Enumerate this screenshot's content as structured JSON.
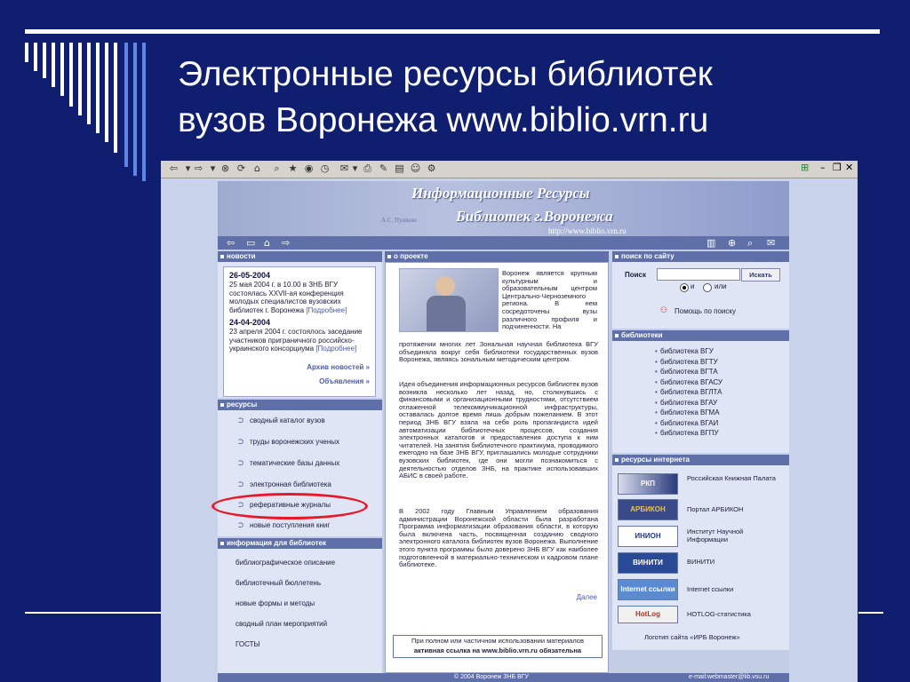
{
  "slide": {
    "title_line1": "Электронные ресурсы библиотек",
    "title_line2": "вузов Воронежа www.biblio.vrn.ru"
  },
  "banner": {
    "title_line1": "Информационные Ресурсы",
    "title_line2": "Библиотек г.Воронежа",
    "url": "http://www.biblio.vrn.ru",
    "signature": "А.С. Пушкин"
  },
  "news": {
    "header": "новости",
    "items": [
      {
        "date": "26-05-2004",
        "text": "25 мая 2004 г. в 10.00 в ЗНБ ВГУ состоялась XXVII-ая конференция молодых специалистов вузовских библиотек г. Воронежа",
        "more": "[Подробнее]"
      },
      {
        "date": "24-04-2004",
        "text": "23 апреля 2004 г. состоялось заседание участников приграничного российско-украинского консорциума",
        "more": "[Подробнее]"
      }
    ],
    "archive_link": "Архив новостей »",
    "ads_link": "Объявления »"
  },
  "resources": {
    "header": "ресурсы",
    "items": [
      "сводный каталог вузов",
      "труды воронежских ученых",
      "тематические базы данных",
      "электронная библиотека",
      "реферативные журналы",
      "новые поступления книг"
    ]
  },
  "info": {
    "header": "информация для библиотек",
    "items": [
      "библиографическое описание",
      "библиотечный бюллетень",
      "новые формы и методы",
      "сводный план мероприятий",
      "ГОСТЫ"
    ]
  },
  "about": {
    "header": "о проекте",
    "p1": "Воронеж является крупным культурным и образовательным центром Центрально-Черноземного региона. В нем сосредоточены вузы различного профиля и подчиненности. На протяжении многих лет Зональная научная библиотека ВГУ объединяла вокруг себя библиотеки государственных вузов Воронежа, являясь зональным методическим центром.",
    "p2": "Идея объединения информационных ресурсов библиотек вузов возникла несколько лет назад, но, столкнувшись с финансовыми и организационными трудностями, отсутствием отлаженной телекоммуникационной инфраструктуры, оставалась долгое время лишь добрым пожеланием. В этот период ЗНБ ВГУ взяла на себя роль пропагандиста идей автоматизации библиотечных процессов, создания электронных каталогов и предоставления доступа к ним читателей. На занятия библиотечного практикума, проводимого ежегодно на базе ЗНБ ВГУ, приглашались молодые сотрудники вузовских библиотек, где они могли познакомиться с деятельностью отделов ЗНБ, на практике использовавших АБИС в своей работе.",
    "p3": "В 2002 году Главным Управлением образования администрации Воронежской области была разработана Программа информатизации образования области, в которую была включена часть, посвященная созданию сводного электронного каталога библиотек вузов Воронежа. Выполнение этого пункта программы было доверено ЗНБ ВГУ как наиболее подготовленной в материально-техническом и кадровом плане библиотеке.",
    "more": "Далее",
    "notice_line1": "При полном или частичном использовании материалов",
    "notice_line2": "активная ссылка на www.biblio.vrn.ru обязательна"
  },
  "search": {
    "header": "поиск по сайту",
    "label": "Поиск",
    "input_value": "",
    "button": "Искать",
    "radio_and": "и",
    "radio_or": "или",
    "help": "Помощь по поиску"
  },
  "libraries": {
    "header": "библиотеки",
    "items": [
      "библиотека ВГУ",
      "библиотека ВГТУ",
      "библиотека ВГТА",
      "библиотека ВГАСУ",
      "библиотека ВГЛТА",
      "библиотека ВГАУ",
      "библиотека ВГМА",
      "библиотека ВГАИ",
      "библиотека ВГПУ"
    ]
  },
  "internet": {
    "header": "ресурсы интернета",
    "items": [
      {
        "logo": "РКП",
        "text": "Российская Книжная Палата"
      },
      {
        "logo": "АРБИКОН",
        "text": "Портал АРБИКОН"
      },
      {
        "logo": "ИНИОН",
        "text": "Институт Научной Информации"
      },
      {
        "logo": "ВИНИТИ",
        "text": "ВИНИТИ"
      },
      {
        "logo": "Internet ссылки",
        "text": "Internet ссылки"
      },
      {
        "logo": "HotLog",
        "text": "HOTLOG-статистика"
      }
    ],
    "logotypes": "Логотип сайта «ИРБ Воронеж»"
  },
  "footer": {
    "copyright": "© 2004 Воронеж ЗНБ ВГУ",
    "email": "e-mail:webmaster@lib.vsu.ru"
  },
  "colors": {
    "slide_bg": "#0f1e6e",
    "section_header": "#5f6fa8",
    "highlight": "#e81828"
  }
}
